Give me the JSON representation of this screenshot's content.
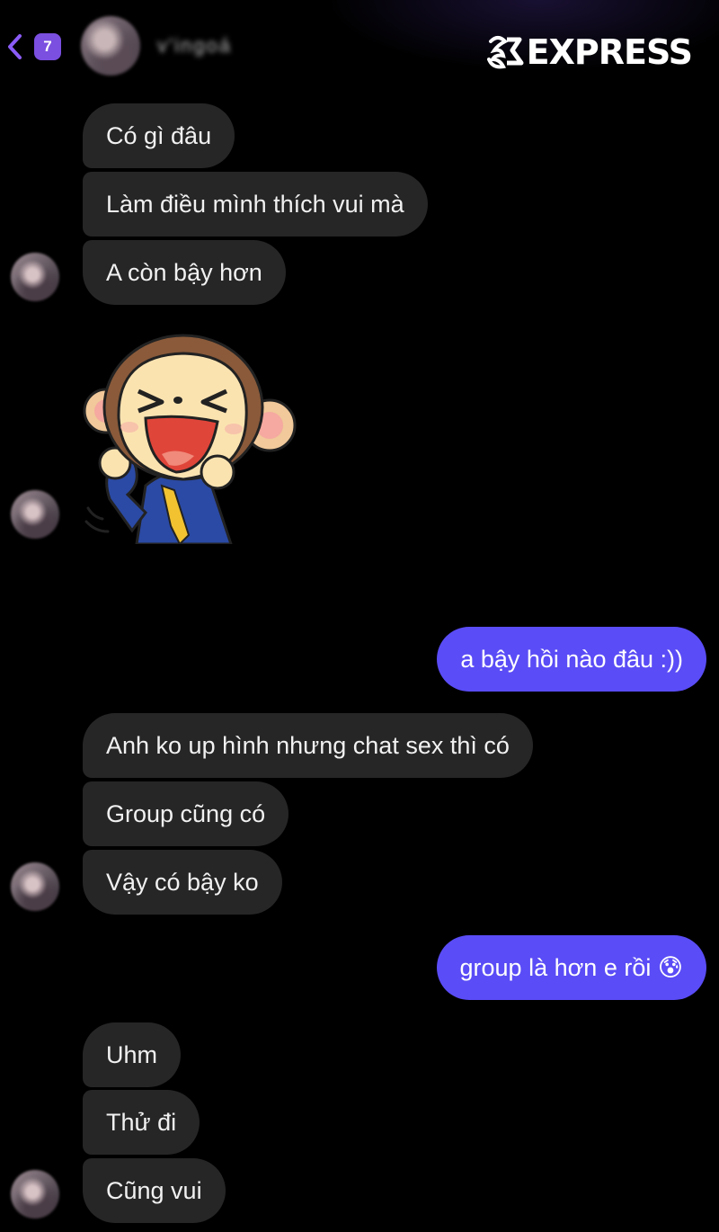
{
  "header": {
    "back_badge_count": "7",
    "contact_name": "v'ingoá",
    "watermark": "EXPRESS"
  },
  "messages": [
    {
      "from": "them",
      "text": "Có gì đâu"
    },
    {
      "from": "them",
      "text": "Làm điều mình thích vui mà"
    },
    {
      "from": "them",
      "text": "A còn bậy hơn"
    },
    {
      "from": "them",
      "type": "sticker",
      "sticker": "laughing-monkey-sticker"
    },
    {
      "from": "me",
      "text": "a bậy hồi nào đâu :))"
    },
    {
      "from": "them",
      "text": "Anh ko up hình nhưng chat sex thì có"
    },
    {
      "from": "them",
      "text": "Group cũng có"
    },
    {
      "from": "them",
      "text": "Vậy có bậy ko"
    },
    {
      "from": "me",
      "text": "group là hơn e rồi 😰"
    },
    {
      "from": "them",
      "text": "Uhm"
    },
    {
      "from": "them",
      "text": "Thử đi"
    },
    {
      "from": "them",
      "text": "Cũng vui"
    }
  ],
  "colors": {
    "background": "#000000",
    "incoming_bubble": "#262626",
    "outgoing_bubble": "#5a4cf6",
    "badge": "#7b4fe0"
  }
}
